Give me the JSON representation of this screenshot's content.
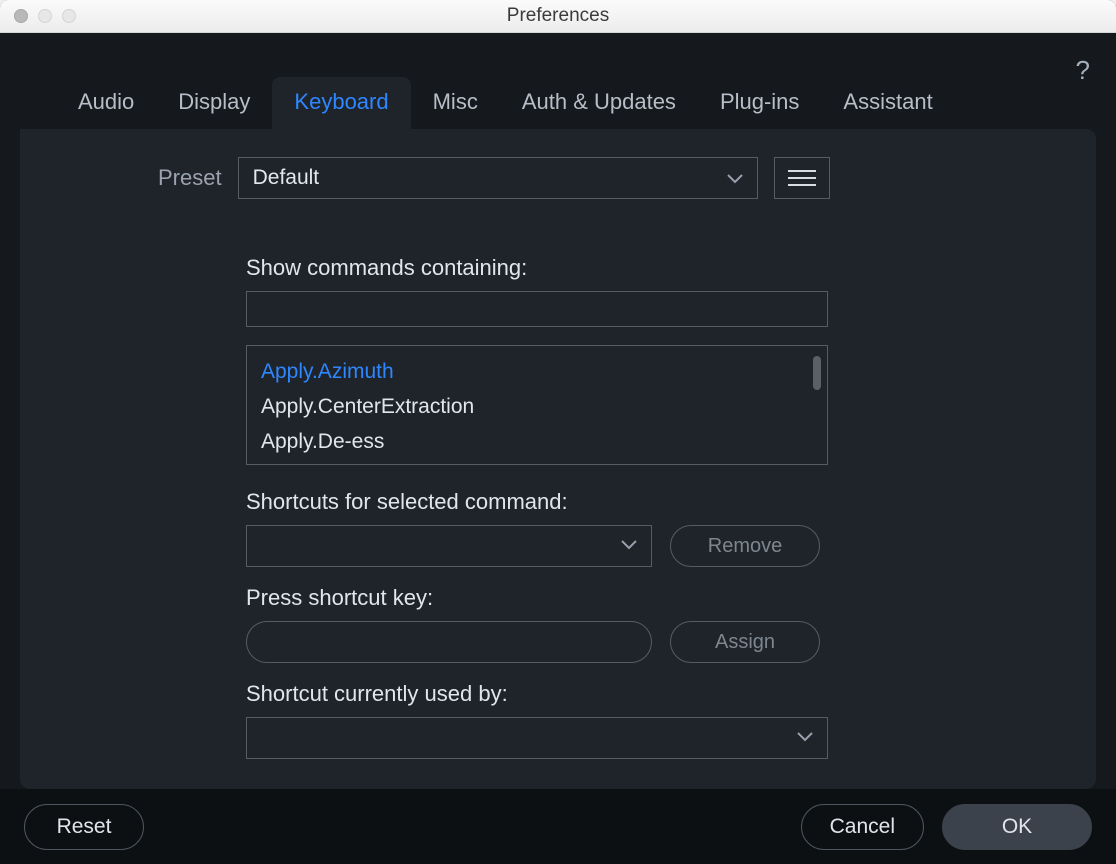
{
  "window": {
    "title": "Preferences"
  },
  "help_tooltip": "?",
  "tabs": {
    "audio": "Audio",
    "display": "Display",
    "keyboard": "Keyboard",
    "misc": "Misc",
    "auth": "Auth & Updates",
    "plugins": "Plug-ins",
    "assistant": "Assistant",
    "active": "keyboard"
  },
  "preset": {
    "label": "Preset",
    "value": "Default"
  },
  "labels": {
    "show_commands": "Show commands containing:",
    "shortcuts_for_selected": "Shortcuts for selected command:",
    "press_shortcut": "Press shortcut key:",
    "used_by": "Shortcut currently used by:"
  },
  "search": {
    "value": ""
  },
  "commands": [
    {
      "id": "Apply.Azimuth",
      "label": "Apply.Azimuth",
      "selected": true
    },
    {
      "id": "Apply.CenterExtraction",
      "label": "Apply.CenterExtraction",
      "selected": false
    },
    {
      "id": "Apply.De-ess",
      "label": "Apply.De-ess",
      "selected": false
    }
  ],
  "shortcut_select": {
    "value": ""
  },
  "shortcut_key_input": {
    "value": ""
  },
  "used_by_select": {
    "value": ""
  },
  "buttons": {
    "remove": "Remove",
    "assign": "Assign",
    "reset": "Reset",
    "cancel": "Cancel",
    "ok": "OK"
  }
}
